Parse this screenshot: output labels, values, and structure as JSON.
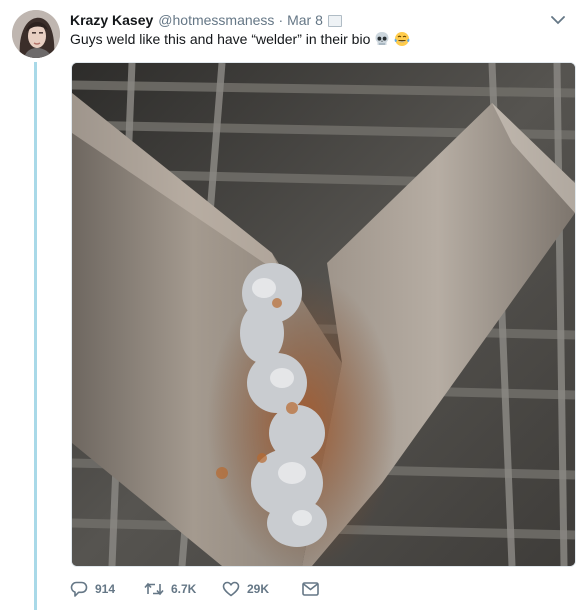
{
  "tweet": {
    "author_name": "Krazy Kasey",
    "handle": "@hotmessmaness",
    "separator": "·",
    "date": "Mar 8",
    "text": "Guys weld like this and have “welder” in their bio",
    "emojis": [
      "skull-emoji",
      "tears-of-joy-emoji"
    ]
  },
  "actions": {
    "replies": "914",
    "retweets": "6.7K",
    "likes": "29K"
  },
  "icons": [
    "avatar",
    "sms-icon",
    "chevron-down-icon",
    "reply-icon",
    "retweet-icon",
    "like-icon",
    "direct-message-icon"
  ],
  "colors": {
    "name": "#14171a",
    "secondary": "#657786",
    "thread_line": "#a9d9e8",
    "accent": "#1da1f2"
  }
}
